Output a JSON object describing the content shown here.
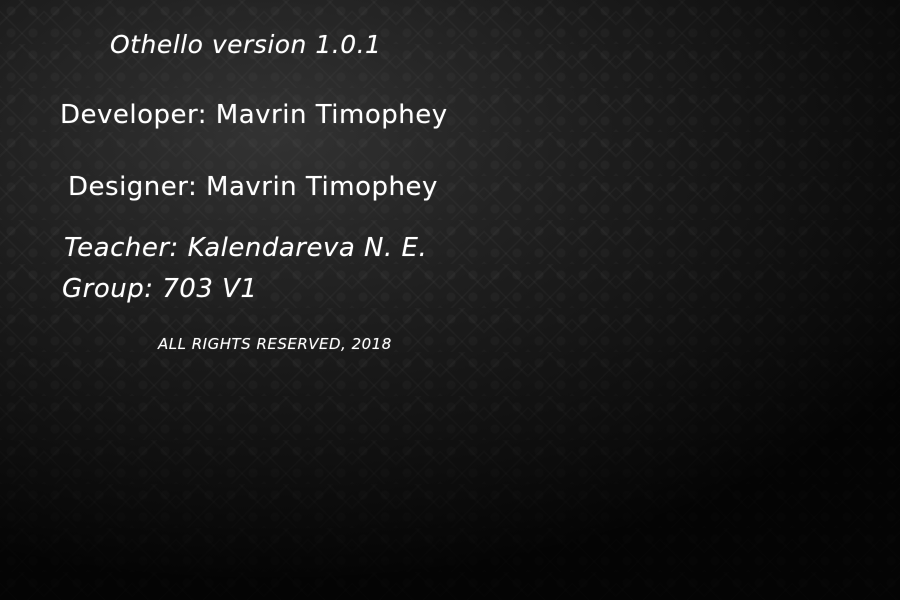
{
  "about": {
    "title": "Othello version 1.0.1",
    "developer": "Developer: Mavrin Timophey",
    "designer": "Designer: Mavrin Timophey",
    "teacher": "Teacher: Kalendareva N. E.",
    "group": "Group: 703 V1",
    "rights": "ALL RIGHTS RESERVED, 2018"
  },
  "colors": {
    "text": "#ffffff",
    "background": "#1c1c1c"
  }
}
